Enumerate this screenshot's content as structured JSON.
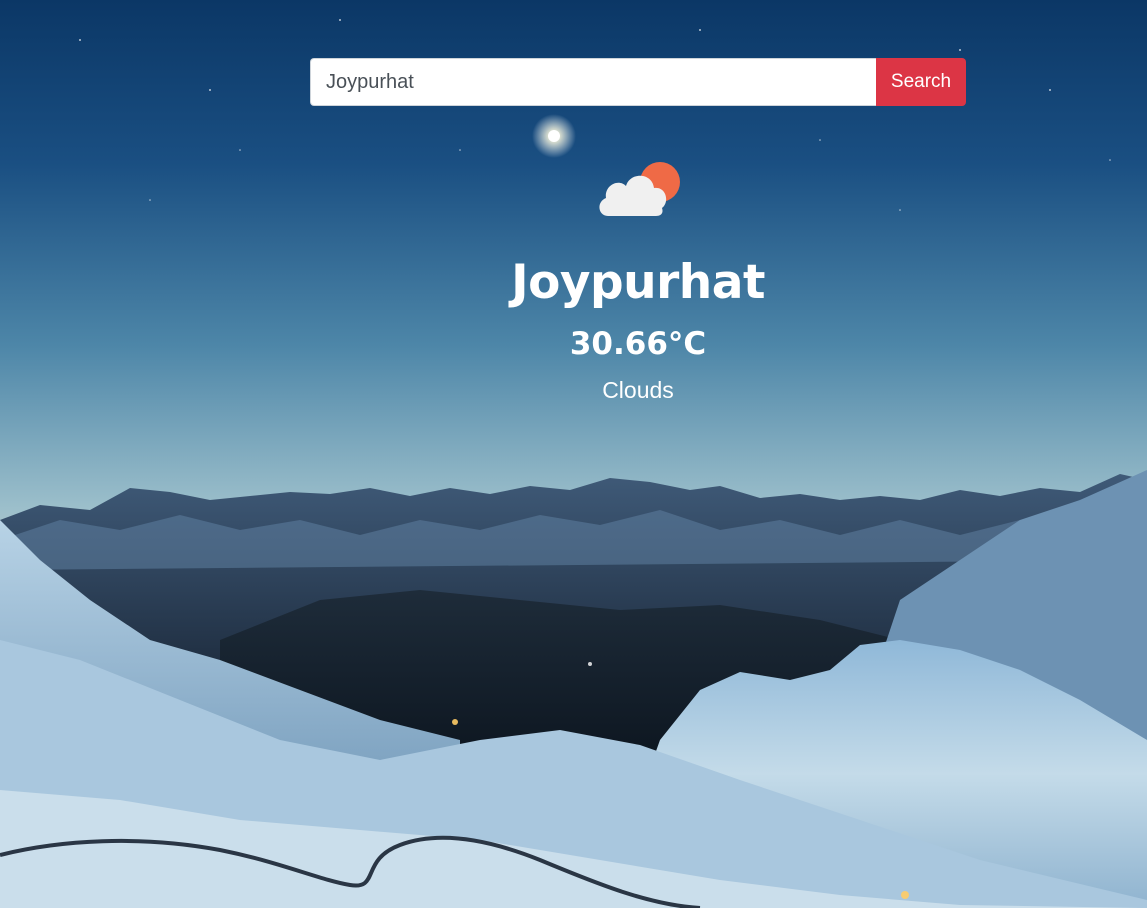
{
  "search": {
    "value": "Joypurhat",
    "button_label": "Search"
  },
  "weather": {
    "icon": "partly-cloudy-sun-icon",
    "city": "Joypurhat",
    "temperature": "30.66°C",
    "condition": "Clouds"
  },
  "colors": {
    "search_button": "#dc3545",
    "text": "#ffffff",
    "sun": "#ef6a46",
    "cloud": "#f0f0f0"
  }
}
